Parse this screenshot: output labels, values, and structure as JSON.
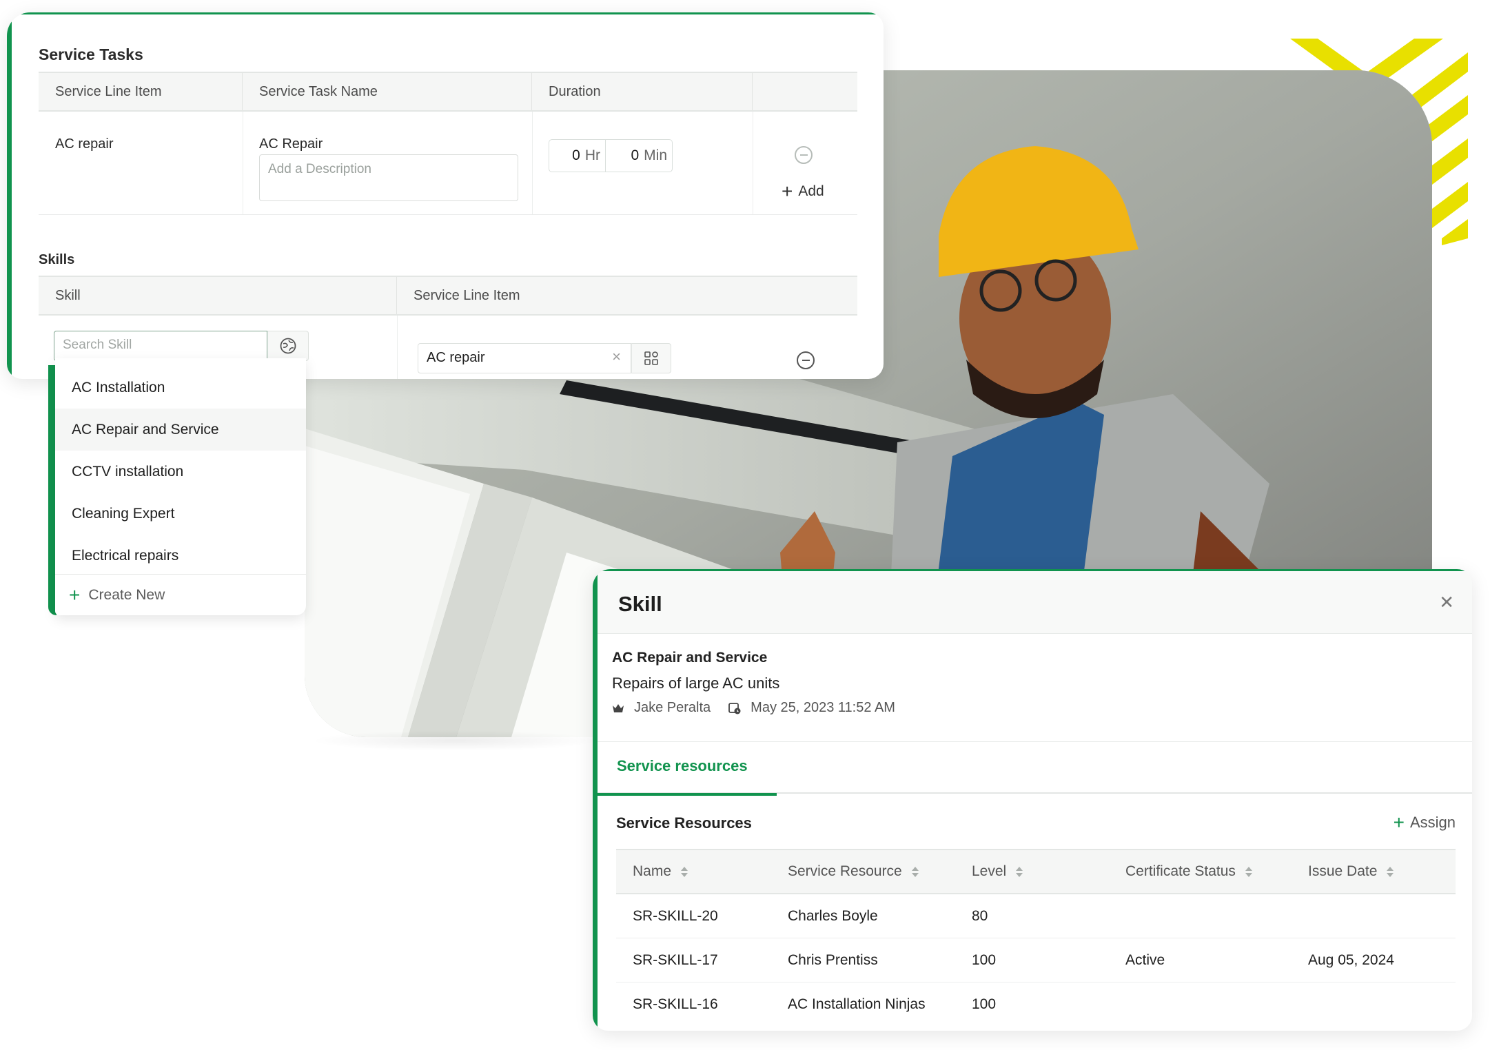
{
  "service_tasks": {
    "title": "Service Tasks",
    "columns": [
      "Service Line Item",
      "Service Task Name",
      "Duration",
      ""
    ],
    "rows": [
      {
        "service_line_item": "AC repair",
        "task_name": "AC Repair",
        "description_placeholder": "Add a Description",
        "duration_hours": "0",
        "hours_unit": "Hr",
        "duration_minutes": "0",
        "minutes_unit": "Min"
      }
    ],
    "add_label": "Add",
    "remove_icon": "minus-circle-icon"
  },
  "skills": {
    "title": "Skills",
    "columns": [
      "Skill",
      "Service Line Item"
    ],
    "search_placeholder": "Search Skill",
    "skill_lookup_icon": "puzzle-globe-icon",
    "service_line_item_value": "AC repair",
    "clear_icon": "close-icon",
    "lookup_icon": "grid-icon"
  },
  "skill_dropdown": {
    "options": [
      "AC Installation",
      "AC Repair and Service",
      "CCTV installation",
      "Cleaning Expert",
      "Electrical repairs"
    ],
    "hovered_index": 1,
    "create_new_label": "Create New"
  },
  "skill_panel": {
    "title": "Skill",
    "close_icon": "close-icon",
    "skill_name": "AC Repair and Service",
    "skill_description": "Repairs of large AC units",
    "owner": "Jake Peralta",
    "owner_icon": "crown-icon",
    "created_at": "May 25, 2023 11:52 AM",
    "created_icon": "calendar-clock-icon",
    "tabs": [
      {
        "label": "Service resources",
        "active": true
      }
    ],
    "resources": {
      "title": "Service Resources",
      "assign_label": "Assign",
      "columns": [
        "Name",
        "Service Resource",
        "Level",
        "Certificate Status",
        "Issue Date"
      ],
      "rows": [
        {
          "name": "SR-SKILL-20",
          "service_resource": "Charles Boyle",
          "level": "80",
          "certificate_status": "",
          "issue_date": ""
        },
        {
          "name": "SR-SKILL-17",
          "service_resource": "Chris Prentiss",
          "level": "100",
          "certificate_status": "Active",
          "issue_date": "Aug 05, 2024"
        },
        {
          "name": "SR-SKILL-16",
          "service_resource": "AC Installation Ninjas",
          "level": "100",
          "certificate_status": "",
          "issue_date": ""
        }
      ]
    }
  },
  "theme": {
    "accent": "#11934e",
    "stripe": "#e8e000",
    "text": "#1f1f1f",
    "muted": "#9aa09c"
  }
}
